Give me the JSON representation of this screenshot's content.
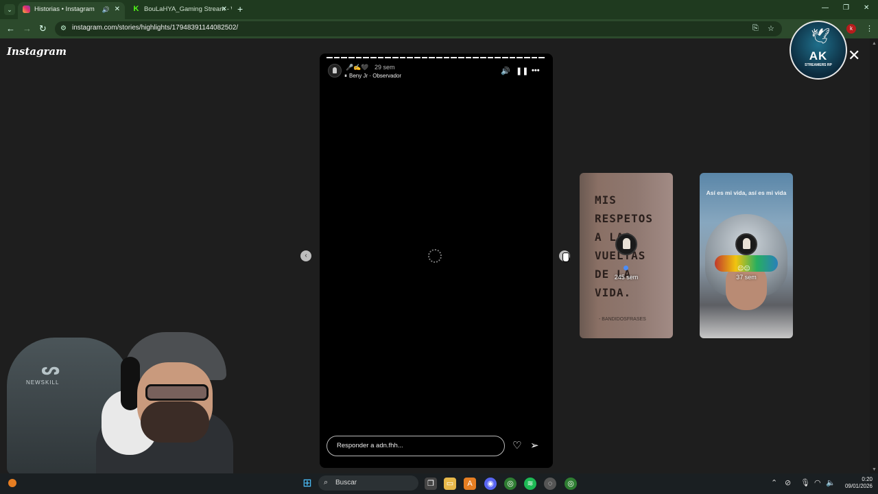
{
  "browser": {
    "tabs": [
      {
        "label": "Historias • Instagram"
      },
      {
        "label": "BouLaHYA_Gaming Stream - W"
      }
    ],
    "url": "instagram.com/stories/highlights/17948391144082502/",
    "profile_letter": "k"
  },
  "page": {
    "logo": "Instagram",
    "close_glyph": "✕"
  },
  "story": {
    "progress_segments_total": 30,
    "progress_segments_done": 30,
    "emojis": "🎤✍️🖤",
    "time": "29 sem",
    "audio_icon": "⏸",
    "audio_label": "Beny Jr · Observador",
    "reply_placeholder": "Responder a adn.fhh...",
    "icons": [
      "speaker-icon",
      "pause-icon",
      "more-icon",
      "heart-icon",
      "send-icon"
    ]
  },
  "previews": [
    {
      "time": "245 sem",
      "text_lines": [
        "MIS",
        "RESPETOS",
        "A LAS",
        "VUELTAS",
        "DE LA",
        "VIDA."
      ],
      "signature": "- BANDIDOSFRASES"
    },
    {
      "time": "37 sem",
      "caption": "Así es mi vida, así es mi vida",
      "emoji": "😐😐"
    }
  ],
  "overlay": {
    "logo_title": "AK",
    "logo_sub": "STREAMERS RP"
  },
  "webcam": {
    "chair_brand": "NEWSKILL"
  },
  "taskbar": {
    "search_label": "Buscar",
    "time": "0:20",
    "date": "09/01/2026"
  },
  "colors": {
    "chrome_green": "#2c4a2c",
    "page_bg": "#1e1e1e",
    "story_bg": "#000000"
  }
}
